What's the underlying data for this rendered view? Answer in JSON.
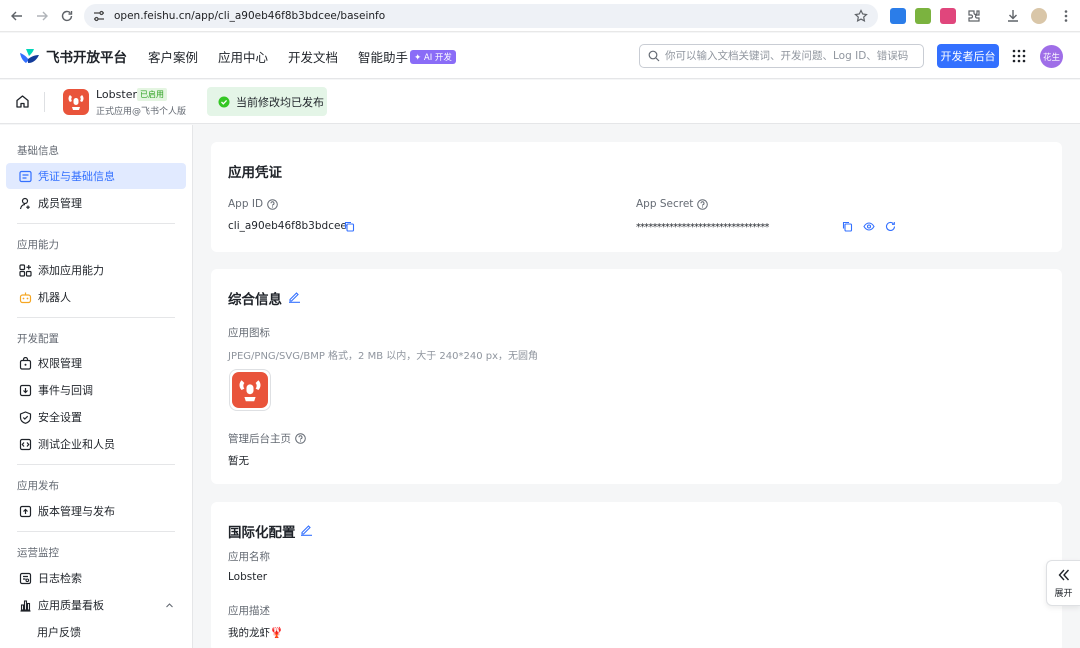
{
  "browser": {
    "url": "open.feishu.cn/app/cli_a90eb46f8b3bdcee/baseinfo"
  },
  "header": {
    "brand": "飞书开放平台",
    "nav": [
      "客户案例",
      "应用中心",
      "开发文档",
      "智能助手"
    ],
    "ai_badge": "AI 开发",
    "search_placeholder": "你可以输入文档关键词、开发问题、Log ID、错误码",
    "dev_console": "开发者后台",
    "avatar": "花生"
  },
  "app": {
    "name": "Lobster",
    "status": "已启用",
    "subtitle": "正式应用@飞书个人版",
    "publish_notice": "当前修改均已发布"
  },
  "sidebar": {
    "groups": [
      {
        "title": "基础信息",
        "items": [
          {
            "label": "凭证与基础信息",
            "icon": "credential-icon",
            "active": true
          },
          {
            "label": "成员管理",
            "icon": "member-icon"
          }
        ]
      },
      {
        "title": "应用能力",
        "items": [
          {
            "label": "添加应用能力",
            "icon": "add-capability-icon"
          },
          {
            "label": "机器人",
            "icon": "robot-icon"
          }
        ]
      },
      {
        "title": "开发配置",
        "items": [
          {
            "label": "权限管理",
            "icon": "permission-icon"
          },
          {
            "label": "事件与回调",
            "icon": "event-icon"
          },
          {
            "label": "安全设置",
            "icon": "shield-icon"
          },
          {
            "label": "测试企业和人员",
            "icon": "test-icon"
          }
        ]
      },
      {
        "title": "应用发布",
        "items": [
          {
            "label": "版本管理与发布",
            "icon": "upload-icon"
          }
        ]
      },
      {
        "title": "运营监控",
        "items": [
          {
            "label": "日志检索",
            "icon": "log-icon"
          },
          {
            "label": "应用质量看板",
            "icon": "chart-icon"
          },
          {
            "label": "用户反馈",
            "icon": ""
          }
        ]
      }
    ]
  },
  "credentials": {
    "title": "应用凭证",
    "app_id_label": "App ID",
    "app_id": "cli_a90eb46f8b3bdcee",
    "app_secret_label": "App Secret",
    "app_secret": "********************************"
  },
  "general": {
    "title": "综合信息",
    "icon_label": "应用图标",
    "icon_hint": "JPEG/PNG/SVG/BMP 格式，2 MB 以内，大于 240*240 px，无圆角",
    "homepage_label": "管理后台主页",
    "homepage_value": "暂无"
  },
  "i18n": {
    "title": "国际化配置",
    "name_label": "应用名称",
    "name_value": "Lobster",
    "desc_label": "应用描述",
    "desc_value": "我的龙虾🦞"
  },
  "expand": {
    "label": "展开"
  },
  "colors": {
    "primary": "#3370ff",
    "app_icon": "#e9543b",
    "success": "#34c724"
  }
}
